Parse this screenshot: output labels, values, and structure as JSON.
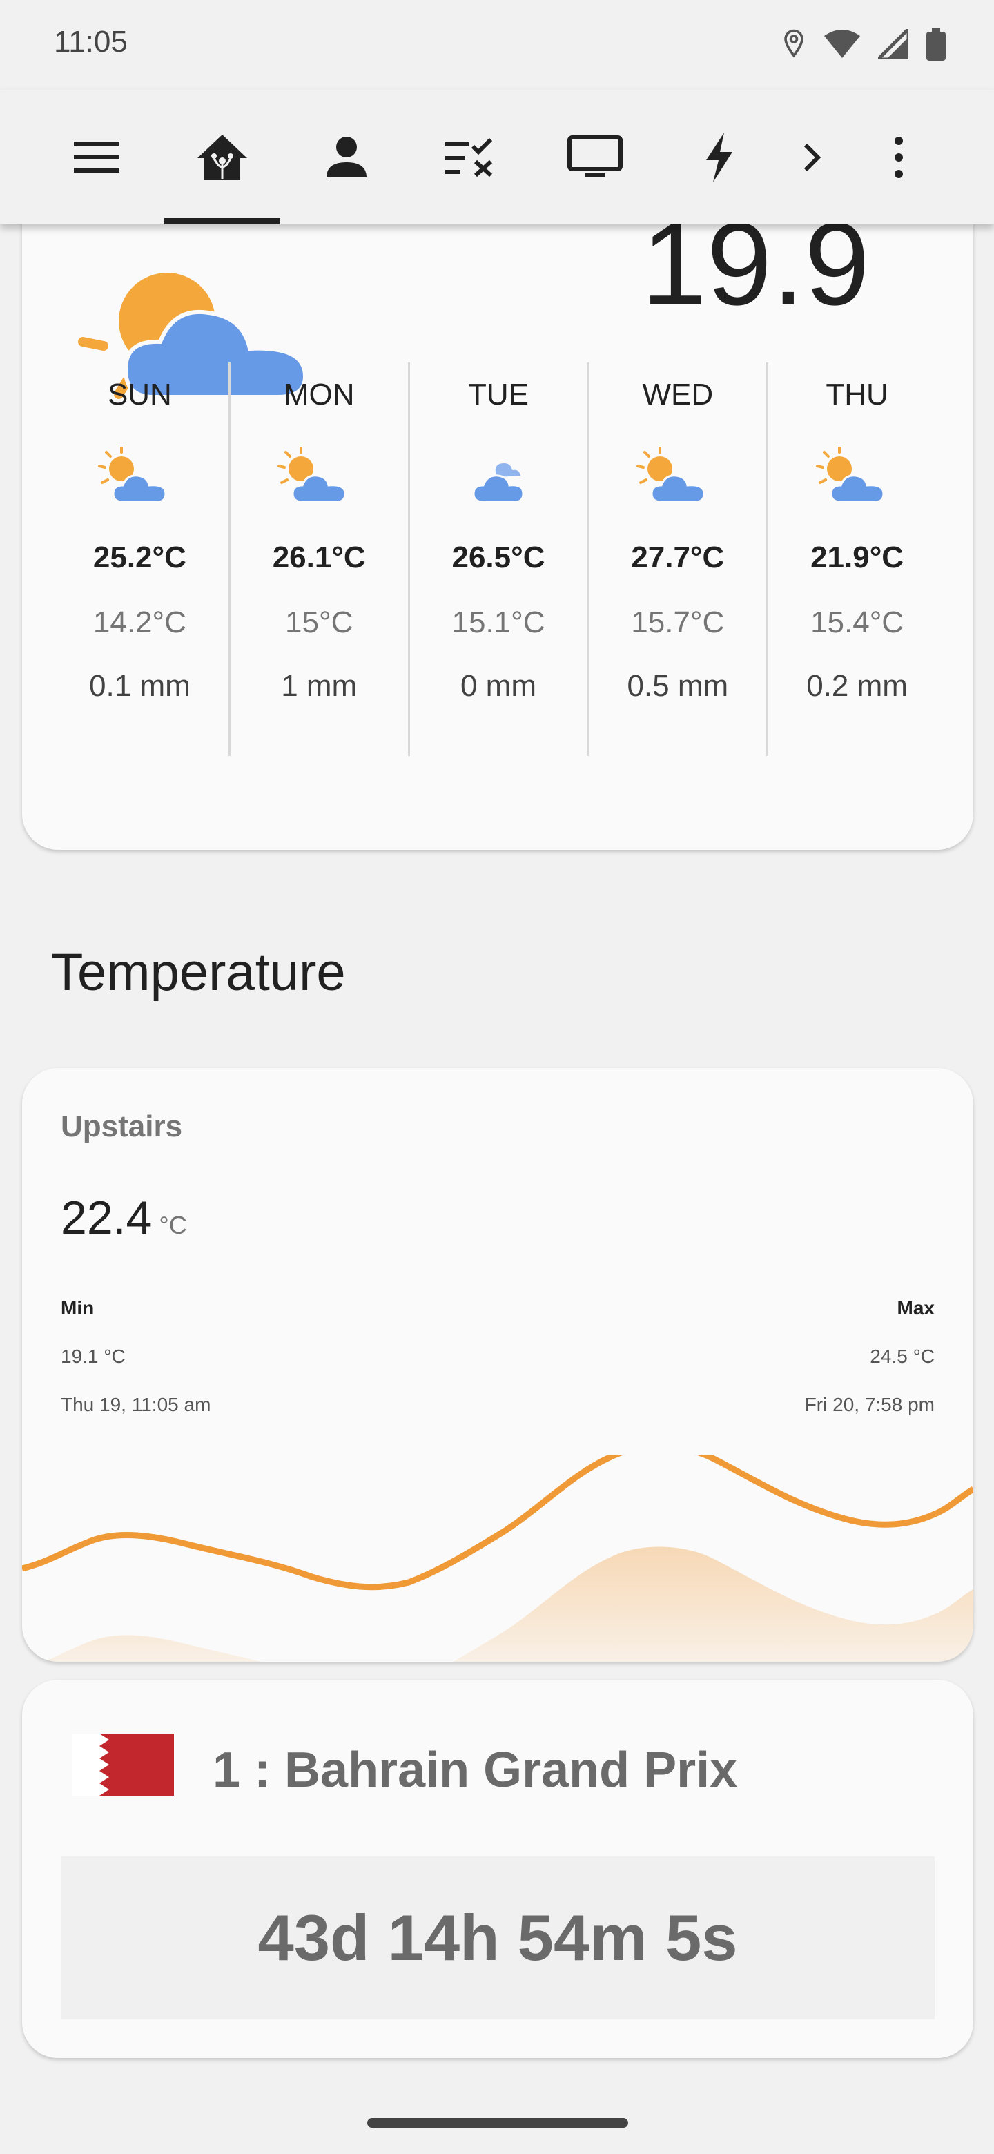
{
  "status_bar": {
    "time": "11:05"
  },
  "nav": {
    "items": [
      "menu-icon",
      "home-assistant-icon",
      "person-icon",
      "checklist-icon",
      "monitor-icon",
      "lightning-icon",
      "chevron-right-icon",
      "more-vert-icon"
    ],
    "active_index": 1
  },
  "weather": {
    "current_temperature": "19.9",
    "forecast": [
      {
        "day": "SUN",
        "icon": "partly-cloudy-icon",
        "high": "25.2°C",
        "low": "14.2°C",
        "precipitation": "0.1 mm"
      },
      {
        "day": "MON",
        "icon": "partly-cloudy-icon",
        "high": "26.1°C",
        "low": "15°C",
        "precipitation": "1 mm"
      },
      {
        "day": "TUE",
        "icon": "cloudy-icon",
        "high": "26.5°C",
        "low": "15.1°C",
        "precipitation": "0 mm"
      },
      {
        "day": "WED",
        "icon": "partly-cloudy-icon",
        "high": "27.7°C",
        "low": "15.7°C",
        "precipitation": "0.5 mm"
      },
      {
        "day": "THU",
        "icon": "partly-cloudy-icon",
        "high": "21.9°C",
        "low": "15.4°C",
        "precipitation": "0.2 mm"
      }
    ]
  },
  "section": {
    "title": "Temperature"
  },
  "temperature_card": {
    "name": "Upstairs",
    "value": "22.4",
    "unit": "°C",
    "min_label": "Min",
    "min_value": "19.1 °C",
    "min_time": "Thu 19, 11:05 am",
    "max_label": "Max",
    "max_value": "24.5 °C",
    "max_time": "Fri 20, 7:58 pm",
    "graph_color": "#f09a37"
  },
  "f1_card": {
    "race": "1 : Bahrain Grand Prix",
    "flag": "bahrain-flag",
    "countdown": "43d 14h 54m 5s"
  },
  "colors": {
    "accent_blue": "#6699e6",
    "sun_orange": "#f4a83b",
    "graph_orange": "#f09a37",
    "flag_red": "#c1272d"
  }
}
